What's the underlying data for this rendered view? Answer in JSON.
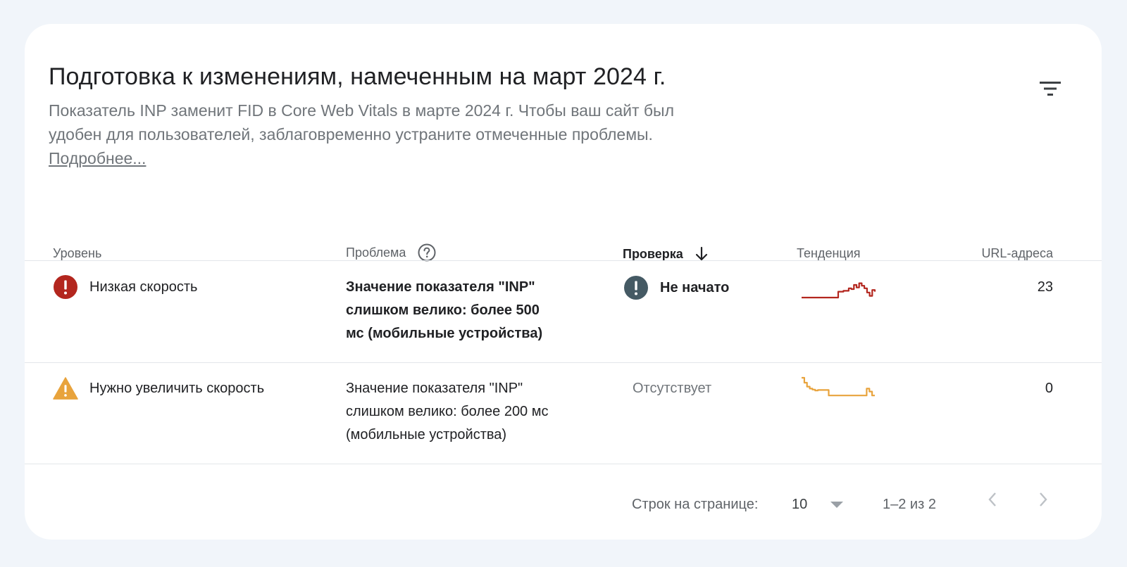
{
  "header": {
    "title": "Подготовка к изменениям, намеченным на март 2024 г.",
    "description": "Показатель INP заменит FID в Core Web Vitals в марте 2024 г. Чтобы ваш сайт был удобен для пользователей, заблаговременно устраните отмеченные проблемы.",
    "learn_more": "Подробнее..."
  },
  "table": {
    "columns": {
      "level": "Уровень",
      "issue": "Проблема",
      "validation": "Проверка",
      "trend": "Тенденция",
      "urls": "URL-адреса"
    },
    "rows": [
      {
        "level": "Низкая скорость",
        "level_icon": "error-icon",
        "issue": "Значение показателя \"INP\" слишком велико: более 500 мс (мобильные устройства)",
        "validation": "Не начато",
        "validation_icon": "alert-circle-icon",
        "trend_color": "#b3261e",
        "trend": [
          0,
          0,
          0,
          0,
          0,
          0,
          0,
          0,
          0,
          0,
          0,
          0,
          0,
          0,
          0.35,
          0.35,
          0.4,
          0.4,
          0.55,
          0.5,
          0.75,
          0.6,
          0.85,
          0.7,
          0.55,
          0.3,
          0.1,
          0.45,
          0.35
        ],
        "urls": "23"
      },
      {
        "level": "Нужно увеличить скорость",
        "level_icon": "warning-icon",
        "issue": "Значение показателя \"INP\" слишком велико: более 200 мс (мобильные устройства)",
        "validation": "Отсутствует",
        "validation_icon": "",
        "trend_color": "#e8a33c",
        "trend": [
          1,
          0.75,
          0.55,
          0.45,
          0.4,
          0.35,
          0.38,
          0.38,
          0.38,
          0.38,
          0.1,
          0.1,
          0.1,
          0.1,
          0.1,
          0.1,
          0.1,
          0.1,
          0.1,
          0.1,
          0.1,
          0.1,
          0.1,
          0.1,
          0.45,
          0.3,
          0.1,
          0.1
        ],
        "urls": "0"
      }
    ]
  },
  "pagination": {
    "rows_per_page_label": "Строк на странице:",
    "rows_per_page_value": "10",
    "range": "1–2 из 2"
  },
  "colors": {
    "error": "#b3261e",
    "warning": "#e8a33c",
    "status_dark": "#455a64"
  }
}
